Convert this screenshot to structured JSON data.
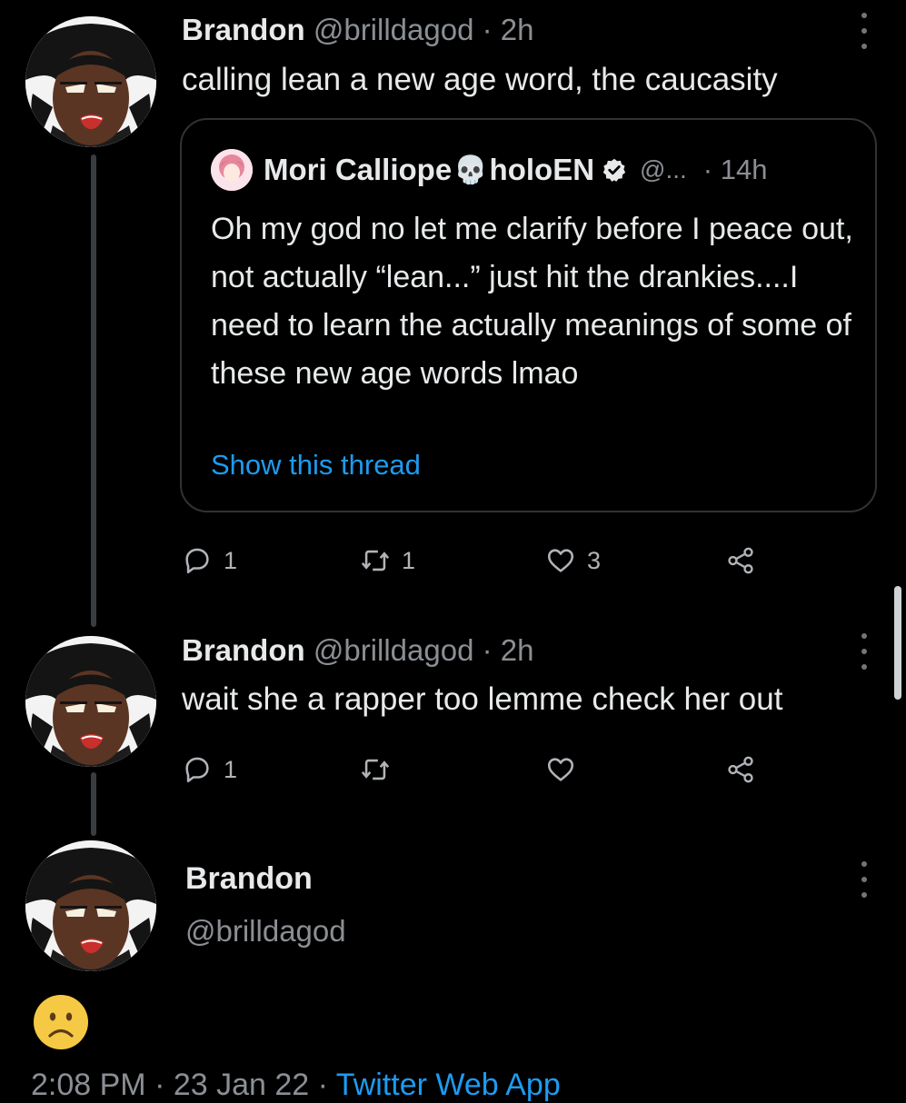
{
  "tweets": [
    {
      "name": "Brandon",
      "handle": "@brilldagod",
      "separator": "·",
      "time": "2h",
      "text": "calling lean a new age word, the caucasity",
      "reply_count": "1",
      "retweet_count": "1",
      "like_count": "3"
    },
    {
      "name": "Brandon",
      "handle": "@brilldagod",
      "separator": "·",
      "time": "2h",
      "text": "wait she a rapper too lemme check her out",
      "reply_count": "1",
      "retweet_count": "",
      "like_count": ""
    }
  ],
  "quote": {
    "name_part1": "Mori Calliope",
    "skull": "💀",
    "name_part2": "holoEN",
    "handle": "@...",
    "time": "· 14h",
    "text": "Oh my god no let me clarify before I peace out, not actually “lean...” just hit the drankies....I need to learn the actually meanings of some of these new age words lmao",
    "link": "Show this thread"
  },
  "main_tweet": {
    "name": "Brandon",
    "handle": "@brilldagod",
    "emoji": "slightly-frowning-face",
    "timestamp": "2:08 PM · 23 Jan 22 · ",
    "source": "Twitter Web App"
  },
  "colors": {
    "background": "#000000",
    "text": "#e7e9ea",
    "muted": "#8b8f94",
    "link": "#1d9bf0",
    "border": "#2f3336"
  },
  "icons": {
    "reply": "reply-icon",
    "retweet": "retweet-icon",
    "like": "heart-icon",
    "share": "share-icon",
    "more": "more-options-icon",
    "verified": "verified-badge-icon"
  }
}
